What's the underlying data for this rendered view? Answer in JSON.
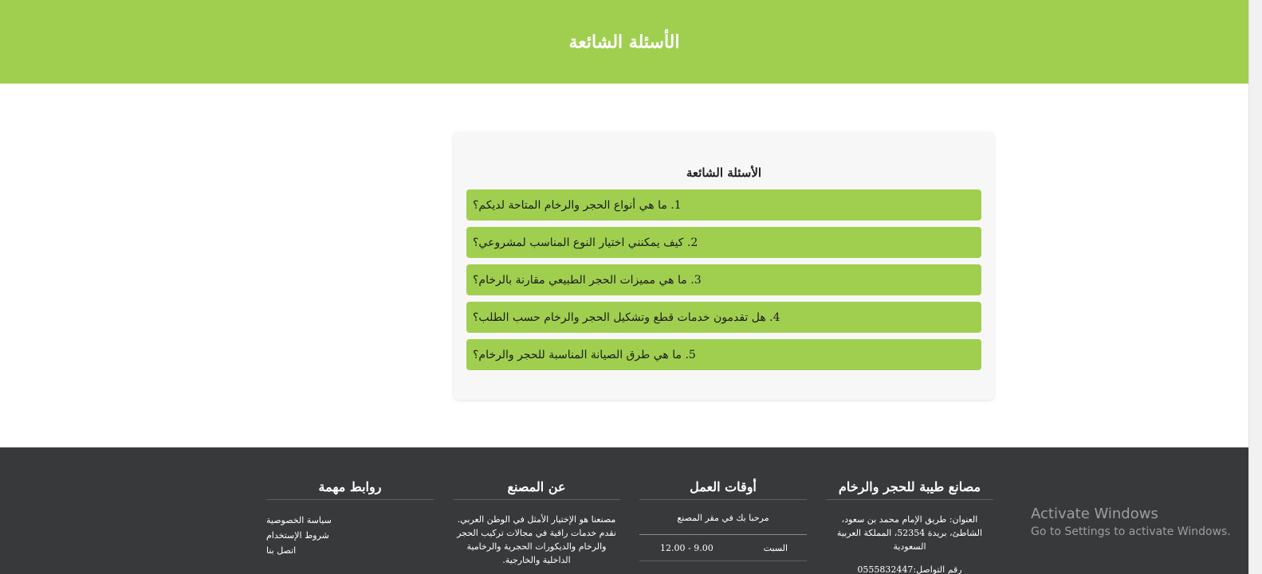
{
  "header": {
    "title": "الأسئلة الشائعة"
  },
  "faq": {
    "title": "الأسئلة الشائعة",
    "items": [
      "1. ما هي أنواع الحجر والرخام المتاحة لديكم؟",
      "2. كيف يمكنني اختيار النوع المناسب لمشروعي؟",
      "3. ما هي مميزات الحجر الطبيعي مقارنة بالرخام؟",
      "4. هل تقدمون خدمات قطع وتشكيل الحجر والرخام حسب الطلب؟",
      "5. ما هي طرق الصيانة المناسبة للحجر والرخام؟"
    ]
  },
  "footer": {
    "company": {
      "title": "مصانع طيبة للحجر والرخام",
      "address": "العنوان: طريق الإمام محمد بن سعود، الشاطئ، بريدة 52354، المملكة العربية السعودية",
      "phone": "رقم التواصل:0555832447"
    },
    "hours": {
      "title": "أوقات العمل",
      "welcome": "مرحبا بك في مقر المصنع",
      "day": "السبت",
      "time": "12.00 - 9.00"
    },
    "about": {
      "title": "عن المصنع",
      "text": "مصنعنا هو الإختيار الأمثل في الوطن العربي. نقدم خدمات راقية في مجالات تركيب الحجر والرخام والديكورات الحجرية والرخامية الداخلية والخارجية."
    },
    "links": {
      "title": "روابط مهمة",
      "items": [
        "سياسة الخصوصية",
        "شروط الإستخدام",
        "اتصل بنا"
      ]
    }
  },
  "watermark": {
    "line1": "Activate Windows",
    "line2": "Go to Settings to activate Windows."
  }
}
